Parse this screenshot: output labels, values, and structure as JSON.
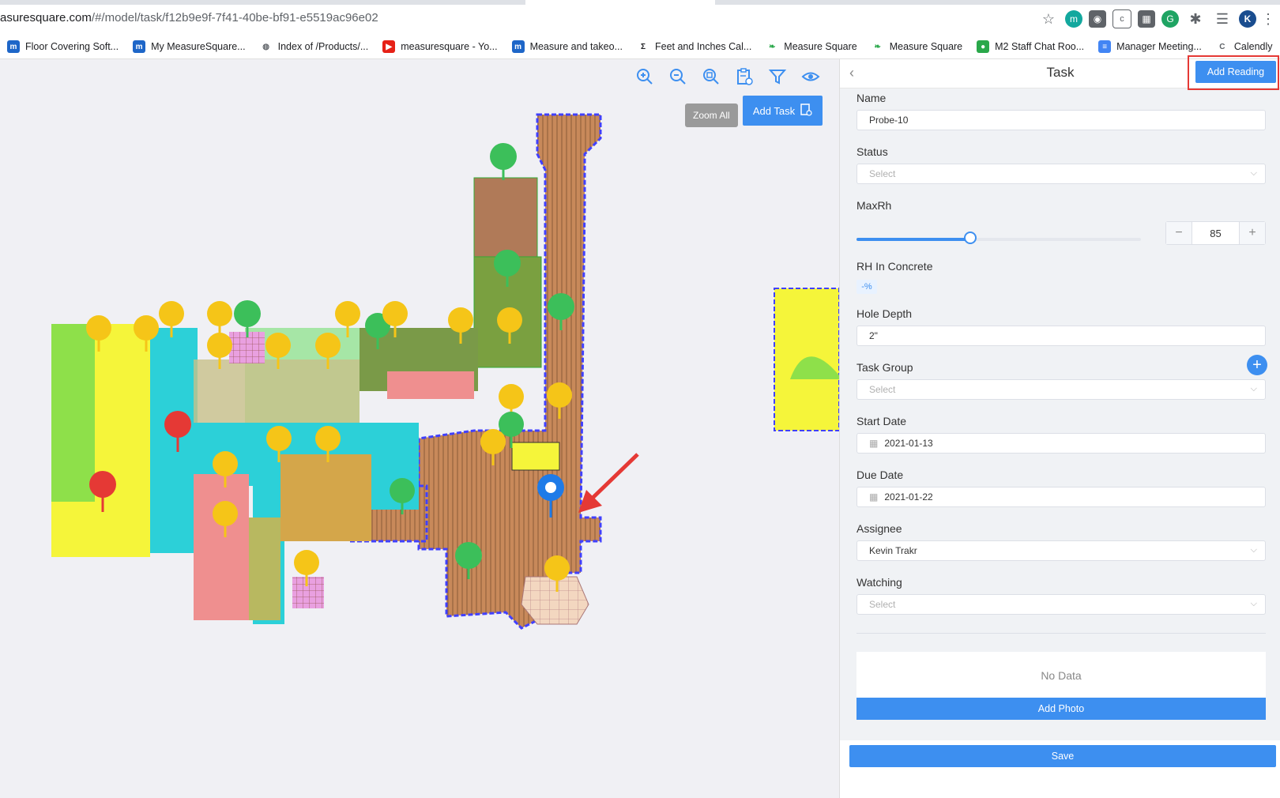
{
  "browser": {
    "url_host": "asuresquare.com",
    "url_path": "/#/model/task/f12b9e9f-7f41-40be-bf91-e5519ac96e02",
    "avatar_letter": "K",
    "bookmarks": [
      {
        "label": "Floor Covering Soft...",
        "icon": "measuresquare-icon",
        "color": "#1e66c8"
      },
      {
        "label": "My MeasureSquare...",
        "icon": "measuresquare-icon",
        "color": "#1e66c8"
      },
      {
        "label": "Index of /Products/...",
        "icon": "globe-icon",
        "color": "#5f6368"
      },
      {
        "label": "measuresquare - Yo...",
        "icon": "youtube-icon",
        "color": "#e62117"
      },
      {
        "label": "Measure and takeo...",
        "icon": "measuresquare-icon",
        "color": "#1e66c8"
      },
      {
        "label": "Feet and Inches Cal...",
        "icon": "sigma-icon",
        "color": "#202124"
      },
      {
        "label": "Measure Square",
        "icon": "leaf-icon",
        "color": "#2aa84a"
      },
      {
        "label": "Measure Square",
        "icon": "leaf-icon",
        "color": "#2aa84a"
      },
      {
        "label": "M2 Staff Chat Roo...",
        "icon": "chat-icon",
        "color": "#2aa84a"
      },
      {
        "label": "Manager Meeting...",
        "icon": "docs-icon",
        "color": "#4285f4"
      },
      {
        "label": "Calendly",
        "icon": "calendly-icon",
        "color": "#5f6368"
      }
    ]
  },
  "canvas": {
    "tooltip": "Zoom All",
    "add_task_label": "Add Task"
  },
  "panel": {
    "title": "Task",
    "add_reading_label": "Add Reading",
    "name_label": "Name",
    "name_value": "Probe-10",
    "status_label": "Status",
    "status_placeholder": "Select",
    "maxrh_label": "MaxRh",
    "maxrh_value": "85",
    "maxrh_fraction": 0.4,
    "rh_label": "RH In Concrete",
    "rh_tag": "-%",
    "hole_label": "Hole Depth",
    "hole_value": "2\"",
    "taskgroup_label": "Task Group",
    "taskgroup_placeholder": "Select",
    "start_label": "Start Date",
    "start_value": "2021-01-13",
    "due_label": "Due Date",
    "due_value": "2021-01-22",
    "assignee_label": "Assignee",
    "assignee_value": "Kevin Trakr",
    "watching_label": "Watching",
    "watching_placeholder": "Select",
    "no_data": "No Data",
    "add_photo_label": "Add Photo",
    "save_label": "Save"
  }
}
